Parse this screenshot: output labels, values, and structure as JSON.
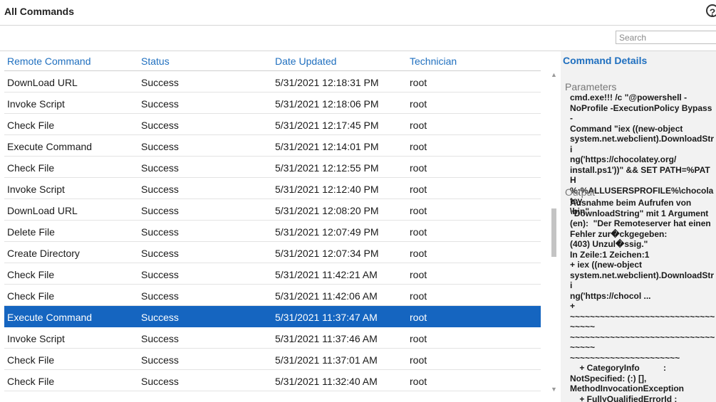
{
  "header": {
    "title": "All Commands",
    "help_icon": "?"
  },
  "search": {
    "placeholder": "Search",
    "value": ""
  },
  "table": {
    "columns": [
      "Remote Command",
      "Status",
      "Date Updated",
      "Technician"
    ],
    "rows": [
      [
        "DownLoad URL",
        "Success",
        "5/31/2021 12:18:31 PM",
        "root"
      ],
      [
        "Invoke Script",
        "Success",
        "5/31/2021 12:18:06 PM",
        "root"
      ],
      [
        "Check File",
        "Success",
        "5/31/2021 12:17:45 PM",
        "root"
      ],
      [
        "Execute Command",
        "Success",
        "5/31/2021 12:14:01 PM",
        "root"
      ],
      [
        "Check File",
        "Success",
        "5/31/2021 12:12:55 PM",
        "root"
      ],
      [
        "Invoke Script",
        "Success",
        "5/31/2021 12:12:40 PM",
        "root"
      ],
      [
        "DownLoad URL",
        "Success",
        "5/31/2021 12:08:20 PM",
        "root"
      ],
      [
        "Delete File",
        "Success",
        "5/31/2021 12:07:49 PM",
        "root"
      ],
      [
        "Create Directory",
        "Success",
        "5/31/2021 12:07:34 PM",
        "root"
      ],
      [
        "Check File",
        "Success",
        "5/31/2021 11:42:21 AM",
        "root"
      ],
      [
        "Check File",
        "Success",
        "5/31/2021 11:42:06 AM",
        "root"
      ],
      [
        "Execute Command",
        "Success",
        "5/31/2021 11:37:47 AM",
        "root"
      ],
      [
        "Invoke Script",
        "Success",
        "5/31/2021 11:37:46 AM",
        "root"
      ],
      [
        "Check File",
        "Success",
        "5/31/2021 11:37:01 AM",
        "root"
      ],
      [
        "Check File",
        "Success",
        "5/31/2021 11:32:40 AM",
        "root"
      ]
    ],
    "selected_index": 11
  },
  "details": {
    "title": "Command Details",
    "parameters_label": "Parameters",
    "parameters": "cmd.exe!!! /c \"@powershell -\nNoProfile -ExecutionPolicy Bypass -\nCommand \"iex ((new-object\nsystem.net.webclient).DownloadStri\nng('https://chocolatey.org/\ninstall.ps1'))\" && SET PATH=%PATH\n%;%ALLUSERSPROFILE%\\chocolatey\n\\bin\"",
    "output_label": "Output",
    "output": "Ausnahme beim Aufrufen von\n\"DownloadString\" mit 1 Argument\n(en):  \"Der Remoteserver hat einen\nFehler zur�ckgegeben:\n(403) Unzul�ssig.\"\nIn Zeile:1 Zeichen:1\n+ iex ((new-object\nsystem.net.webclient).DownloadStri\nng('https://chocol ...\n+\n~~~~~~~~~~~~~~~~~~~~~~~~~~~~~~~~~~\n~~~~~~~~~~~~~~~~~~~~~~~~~~~~~~~~~~\n~~~~~~~~~~~~~~~~~~~~~~\n    + CategoryInfo          :\nNotSpecified: (:) [],\nMethodInvocationException\n    + FullyQualifiedErrorId :\nWebException"
  },
  "colors": {
    "accent": "#1f6fbf",
    "selected_row": "#1565c0",
    "panel_bg": "#f2f2f2"
  }
}
